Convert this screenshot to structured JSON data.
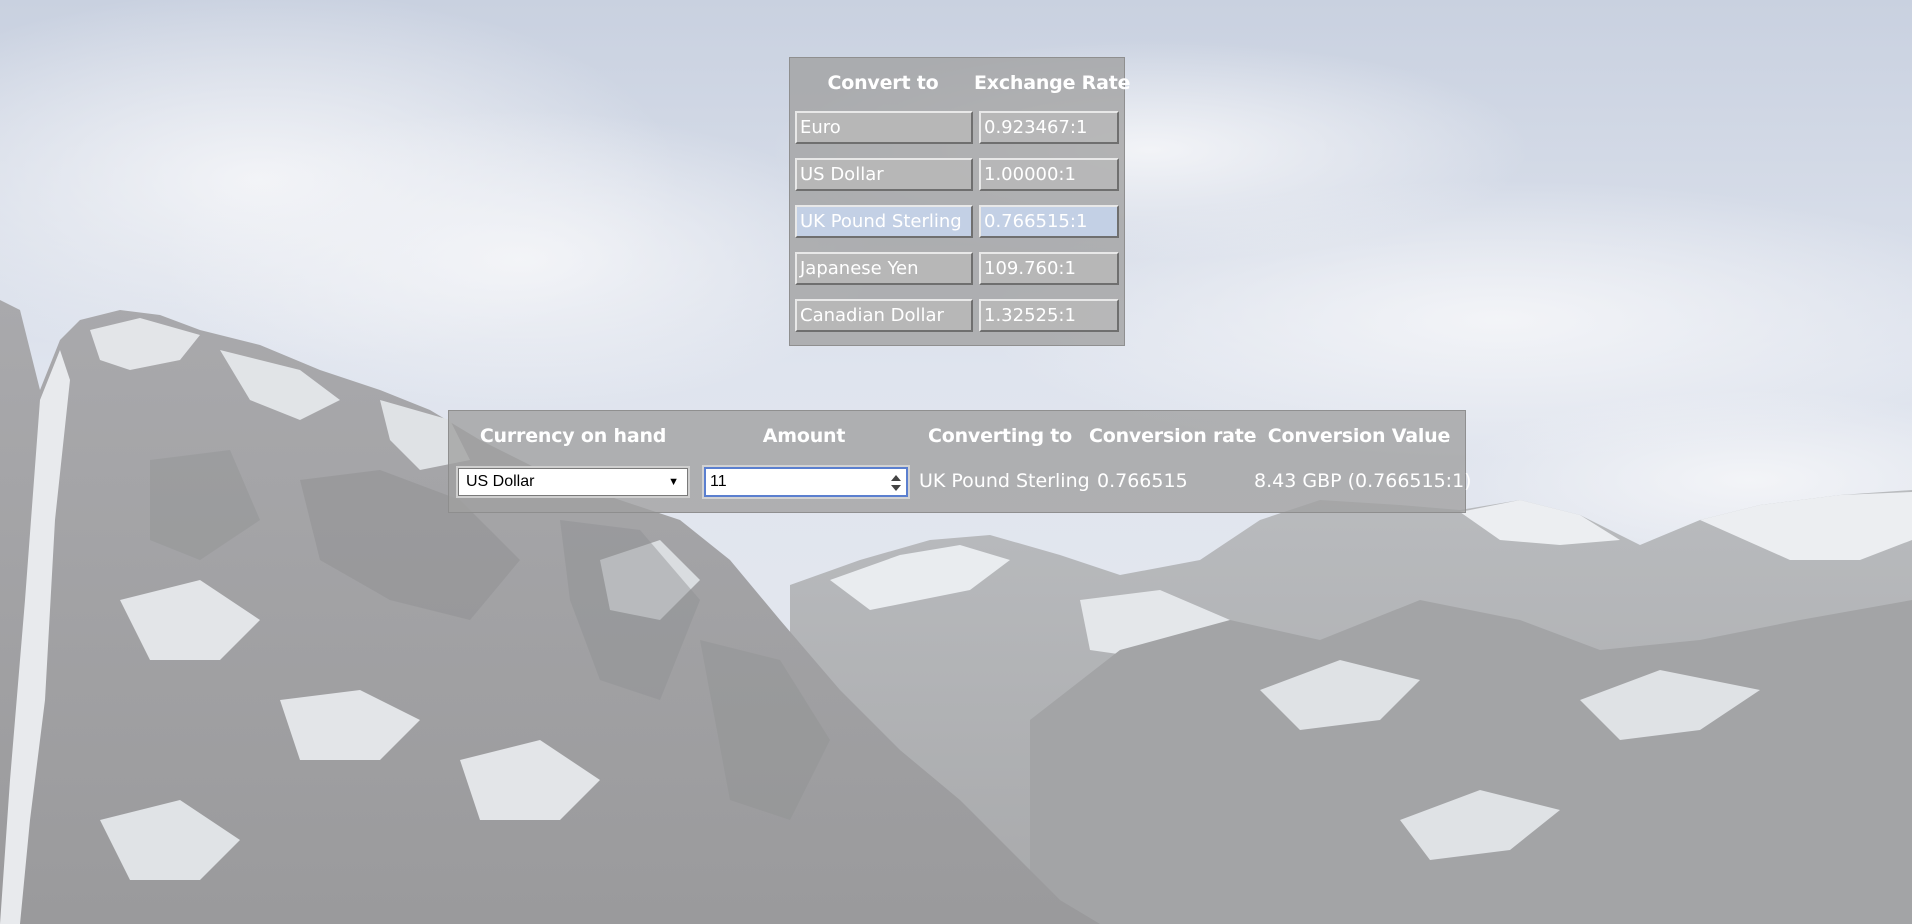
{
  "rates_table": {
    "headers": {
      "convert_to": "Convert to",
      "exchange_rate": "Exchange Rate"
    },
    "rows": [
      {
        "currency": "Euro",
        "rate": "0.923467:1",
        "selected": false
      },
      {
        "currency": "US Dollar",
        "rate": "1.00000:1",
        "selected": false
      },
      {
        "currency": "UK Pound Sterling",
        "rate": "0.766515:1",
        "selected": true
      },
      {
        "currency": "Japanese Yen",
        "rate": "109.760:1",
        "selected": false
      },
      {
        "currency": "Canadian Dollar",
        "rate": "1.32525:1",
        "selected": false
      }
    ]
  },
  "converter": {
    "headers": {
      "currency_on_hand": "Currency on hand",
      "amount": "Amount",
      "converting_to": "Converting to",
      "conversion_rate": "Conversion rate",
      "conversion_value": "Conversion Value"
    },
    "currency_on_hand_value": "US Dollar",
    "amount_value": "11",
    "converting_to_value": "UK Pound Sterling",
    "conversion_rate_value": "0.766515",
    "conversion_value_value": "8.43 GBP (0.766515:1)"
  },
  "icons": {
    "select_arrow": "dropdown-arrow-icon",
    "spinner": "spinner-icon"
  },
  "colors": {
    "panel_bg": "#a0a0a0",
    "selected_row": "#c4d2e8",
    "text": "#ffffff",
    "input_focus_border": "#5b7fcf"
  }
}
